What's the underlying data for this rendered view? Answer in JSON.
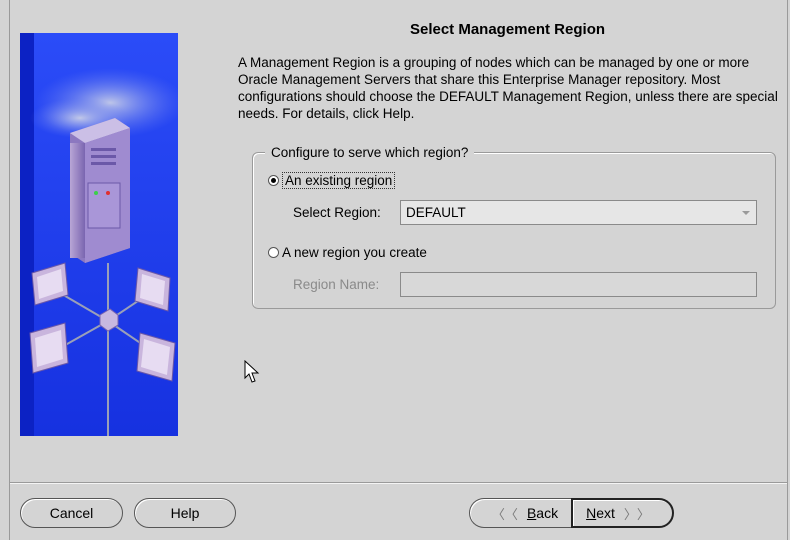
{
  "page": {
    "title": "Select Management Region",
    "description": "A Management Region is a grouping of nodes which can be managed by one or more Oracle Management Servers that share this Enterprise Manager repository.  Most configurations should choose the DEFAULT Management Region, unless there are special needs.  For details, click Help."
  },
  "group": {
    "legend": "Configure to serve which region?",
    "option_existing": {
      "label": "An existing region",
      "checked": true
    },
    "select_region_label": "Select Region:",
    "select_region_value": "DEFAULT",
    "option_new": {
      "label": "A new region you create",
      "checked": false
    },
    "region_name_label": "Region Name:",
    "region_name_value": ""
  },
  "buttons": {
    "cancel": "Cancel",
    "help": "Help",
    "back_mnemonic": "B",
    "back_rest": "ack",
    "next_mnemonic": "N",
    "next_rest": "ext"
  },
  "icons": {
    "back": "chevron-left-icon",
    "next": "chevron-right-icon"
  },
  "colors": {
    "banner_blue": "#1b3df2",
    "background": "#d4d4d4"
  }
}
